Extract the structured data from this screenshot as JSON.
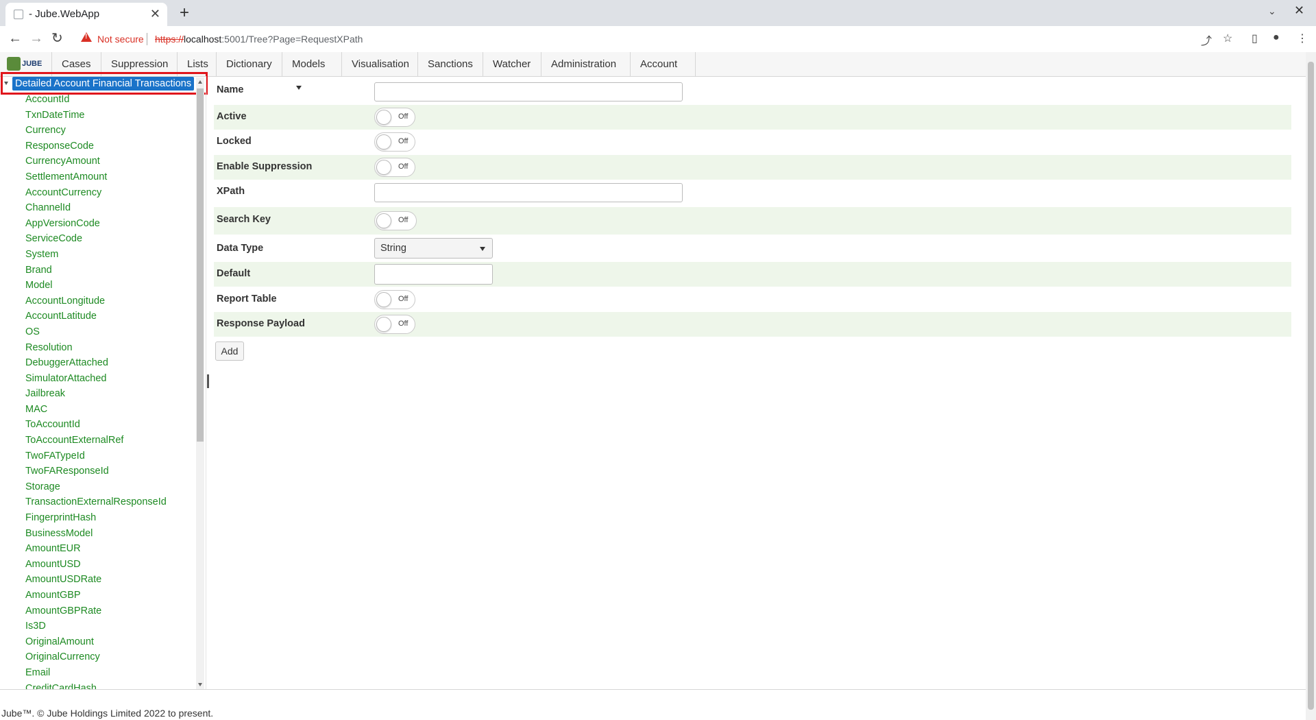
{
  "browser": {
    "tab_title": "- Jube.WebApp",
    "not_secure": "Not secure",
    "url_scheme": "https://",
    "url_host": "localhost",
    "url_rest": ":5001/Tree?Page=RequestXPath"
  },
  "nav": {
    "logo_text": "JUBE",
    "items": [
      "Cases",
      "Suppression",
      "Lists",
      "Dictionary",
      "Models",
      "Visualisation",
      "Sanctions",
      "Watcher",
      "Administration",
      "Account"
    ]
  },
  "tree": {
    "root": "Detailed Account Financial Transactions",
    "items": [
      "AccountId",
      "TxnDateTime",
      "Currency",
      "ResponseCode",
      "CurrencyAmount",
      "SettlementAmount",
      "AccountCurrency",
      "ChannelId",
      "AppVersionCode",
      "ServiceCode",
      "System",
      "Brand",
      "Model",
      "AccountLongitude",
      "AccountLatitude",
      "OS",
      "Resolution",
      "DebuggerAttached",
      "SimulatorAttached",
      "Jailbreak",
      "MAC",
      "ToAccountId",
      "ToAccountExternalRef",
      "TwoFATypeId",
      "TwoFAResponseId",
      "Storage",
      "TransactionExternalResponseId",
      "FingerprintHash",
      "BusinessModel",
      "AmountEUR",
      "AmountUSD",
      "AmountUSDRate",
      "AmountGBP",
      "AmountGBPRate",
      "Is3D",
      "OriginalAmount",
      "OriginalCurrency",
      "Email",
      "CreditCardHash"
    ]
  },
  "form": {
    "name_label": "Name",
    "name_value": "",
    "active_label": "Active",
    "active_state": "Off",
    "locked_label": "Locked",
    "locked_state": "Off",
    "suppression_label": "Enable Suppression",
    "suppression_state": "Off",
    "xpath_label": "XPath",
    "xpath_value": "",
    "searchkey_label": "Search Key",
    "searchkey_state": "Off",
    "datatype_label": "Data Type",
    "datatype_value": "String",
    "default_label": "Default",
    "default_value": "",
    "reporttable_label": "Report Table",
    "reporttable_state": "Off",
    "responsepayload_label": "Response Payload",
    "responsepayload_state": "Off",
    "add_label": "Add"
  },
  "footer": "Jube™. © Jube Holdings Limited 2022 to present.",
  "colors": {
    "tree_link": "#1d8a22",
    "tree_selected": "#1a73c9",
    "highlight_box": "#e0161c",
    "alt_row": "#eef6ea"
  }
}
